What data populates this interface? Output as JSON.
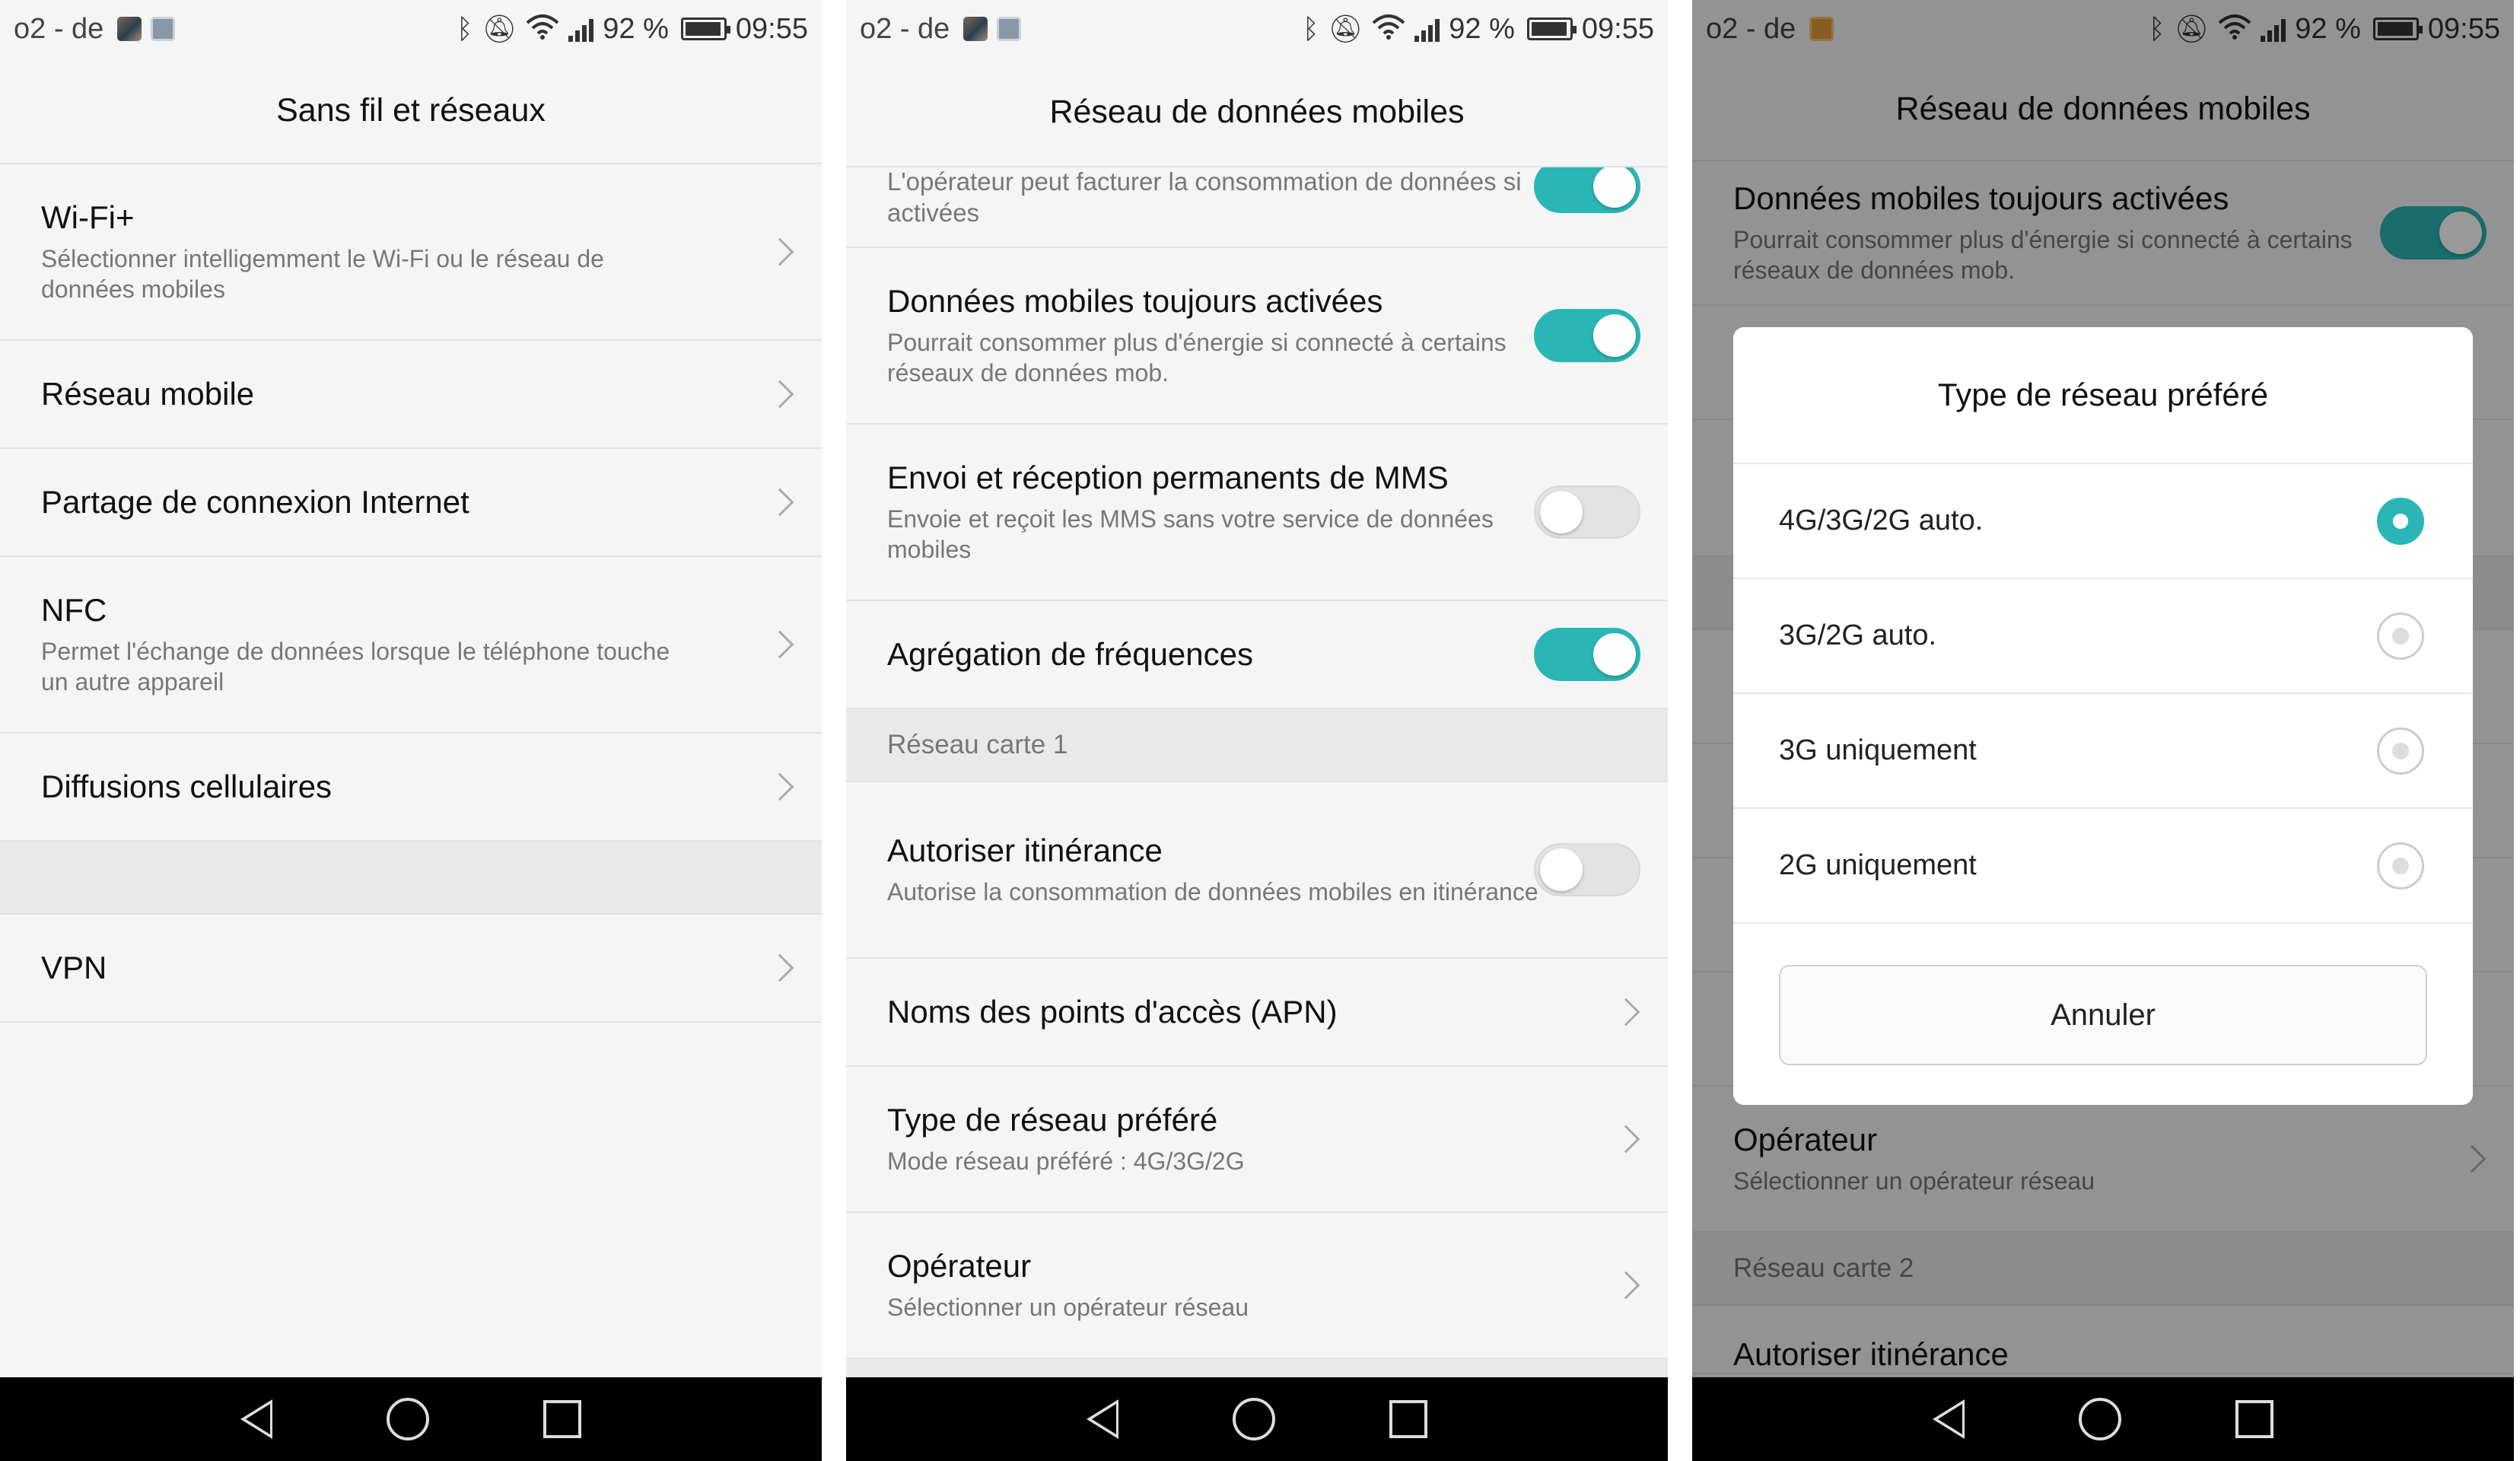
{
  "status": {
    "carrier": "o2 - de",
    "battery": "92 %",
    "time": "09:55",
    "icons": [
      "notif-photo-icon",
      "notif-box-icon",
      "bluetooth-icon",
      "mute-icon",
      "wifi-icon",
      "signal-icon",
      "battery-icon"
    ]
  },
  "screen1": {
    "title": "Sans fil et réseaux",
    "items": [
      {
        "title": "Wi-Fi+",
        "subtitle": "Sélectionner intelligemment le Wi-Fi ou le réseau de données mobiles"
      },
      {
        "title": "Réseau mobile"
      },
      {
        "title": "Partage de connexion Internet"
      },
      {
        "title": "NFC",
        "subtitle": "Permet l'échange de données lorsque le téléphone touche un autre appareil"
      },
      {
        "title": "Diffusions cellulaires"
      },
      {
        "title": "VPN"
      }
    ]
  },
  "screen2": {
    "title": "Réseau de données mobiles",
    "partial_subtitle": "L'opérateur peut facturer la consommation de données si activées",
    "items": [
      {
        "title": "Données mobiles toujours activées",
        "subtitle": "Pourrait consommer plus d'énergie si connecté à certains réseaux de données mob.",
        "toggle": true
      },
      {
        "title": "Envoi et réception permanents de MMS",
        "subtitle": "Envoie et reçoit les MMS sans votre service de données mobiles",
        "toggle": false
      },
      {
        "title": "Agrégation de fréquences",
        "toggle": true
      }
    ],
    "section": "Réseau carte 1",
    "items2": [
      {
        "title": "Autoriser itinérance",
        "subtitle": "Autorise la consommation de données mobiles en itinérance",
        "toggle": false
      },
      {
        "title": "Noms des points d'accès (APN)"
      },
      {
        "title": "Type de réseau préféré",
        "subtitle": "Mode réseau préféré : 4G/3G/2G"
      },
      {
        "title": "Opérateur",
        "subtitle": "Sélectionner un opérateur réseau"
      }
    ]
  },
  "screen3": {
    "title": "Réseau de données mobiles",
    "bg_item": {
      "title": "Données mobiles toujours activées",
      "subtitle": "Pourrait consommer plus d'énergie si connecté à certains réseaux de données mob.",
      "toggle": true
    },
    "bg_operator": {
      "title": "Opérateur",
      "subtitle": "Sélectionner un opérateur réseau"
    },
    "bg_section": "Réseau carte 2",
    "bg_partial": "Autoriser itinérance",
    "dialog": {
      "title": "Type de réseau préféré",
      "options": [
        {
          "label": "4G/3G/2G auto.",
          "selected": true
        },
        {
          "label": "3G/2G auto.",
          "selected": false
        },
        {
          "label": "3G uniquement",
          "selected": false
        },
        {
          "label": "2G uniquement",
          "selected": false
        }
      ],
      "cancel": "Annuler"
    }
  },
  "colors": {
    "accent": "#2ab6b5",
    "background": "#f5f5f5",
    "navbar": "#000000"
  }
}
